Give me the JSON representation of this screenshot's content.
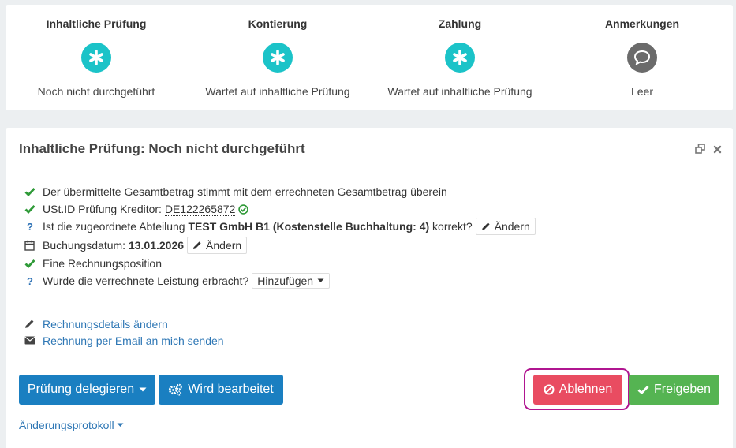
{
  "steps": [
    {
      "title": "Inhaltliche Prüfung",
      "status": "Noch nicht durchgeführt",
      "icon": "asterisk-icon",
      "color": "#1bc3c8"
    },
    {
      "title": "Kontierung",
      "status": "Wartet auf inhaltliche Prüfung",
      "icon": "asterisk-icon",
      "color": "#1bc3c8"
    },
    {
      "title": "Zahlung",
      "status": "Wartet auf inhaltliche Prüfung",
      "icon": "asterisk-icon",
      "color": "#1bc3c8"
    },
    {
      "title": "Anmerkungen",
      "status": "Leer",
      "icon": "speech-bubble-icon",
      "color": "#6b6b6b"
    }
  ],
  "card": {
    "title": "Inhaltliche Prüfung: Noch nicht durchgeführt"
  },
  "checks": {
    "total": "Der übermittelte Gesamtbetrag stimmt mit dem errechneten Gesamtbetrag überein",
    "ustid_label": "USt.ID Prüfung Kreditor: ",
    "ustid_value": "DE122265872",
    "dept_prefix": "Ist die zugeordnete Abteilung ",
    "dept_name": "TEST GmbH B1 (Kostenstelle Buchhaltung: 4)",
    "dept_suffix": " korrekt?",
    "change_label": "Ändern",
    "date_label": "Buchungsdatum: ",
    "date_value": "13.01.2026",
    "position": "Eine Rechnungsposition",
    "service_question": "Wurde die verrechnete Leistung erbracht?",
    "add_label": "Hinzufügen"
  },
  "links": {
    "edit_details": "Rechnungsdetails ändern",
    "email": "Rechnung per Email an mich senden"
  },
  "actions": {
    "delegate": "Prüfung delegieren",
    "in_progress": "Wird bearbeitet",
    "reject": "Ablehnen",
    "approve": "Freigeben"
  },
  "footer": {
    "protocol": "Änderungsprotokoll"
  },
  "colors": {
    "teal": "#1bc3c8",
    "blue": "#1a7fc1",
    "red": "#e94c61",
    "green": "#55b452",
    "highlight": "#b01590"
  }
}
